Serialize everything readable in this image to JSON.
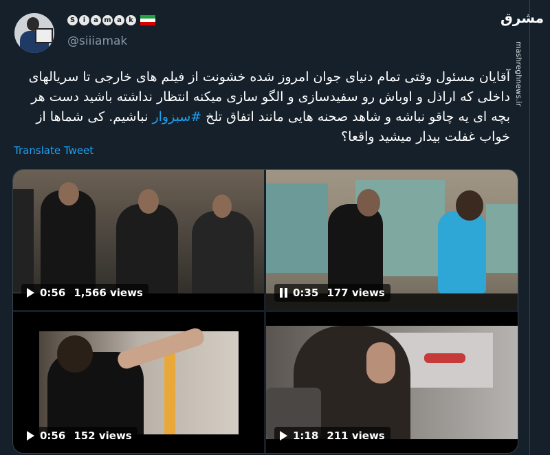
{
  "user": {
    "display_name_letters": [
      "S",
      "i",
      "a",
      "m",
      "a",
      "k"
    ],
    "handle": "@siiiamak",
    "flag": "iran-flag-icon"
  },
  "watermark": {
    "logo": "مشرق",
    "site": "mashreghnews.ir"
  },
  "tweet": {
    "text": "آقایان مسئول وقتی تمام دنیای جوان امروز شده خشونت از فیلم های خارجی تا سریالهای داخلی که اراذل و اوباش رو سفیدسازی و الگو سازی میکنه انتظار نداشته باشید دست هر بچه ای یه چاقو نباشه و شاهد صحنه هایی مانند اتفاق تلخ",
    "hashtag": "#سبزوار",
    "text_end": "نباشیم. کی شماها از خواب غفلت بیدار میشید واقعا؟",
    "translate_label": "Translate Tweet"
  },
  "videos": [
    {
      "duration": "0:56",
      "views": "1,566 views",
      "state": "play"
    },
    {
      "duration": "0:35",
      "views": "177 views",
      "state": "pause"
    },
    {
      "duration": "0:56",
      "views": "152 views",
      "state": "play"
    },
    {
      "duration": "1:18",
      "views": "211 views",
      "state": "play"
    }
  ],
  "colors": {
    "background": "#15202b",
    "accent": "#1da1f2",
    "secondary_text": "#8899a6"
  }
}
